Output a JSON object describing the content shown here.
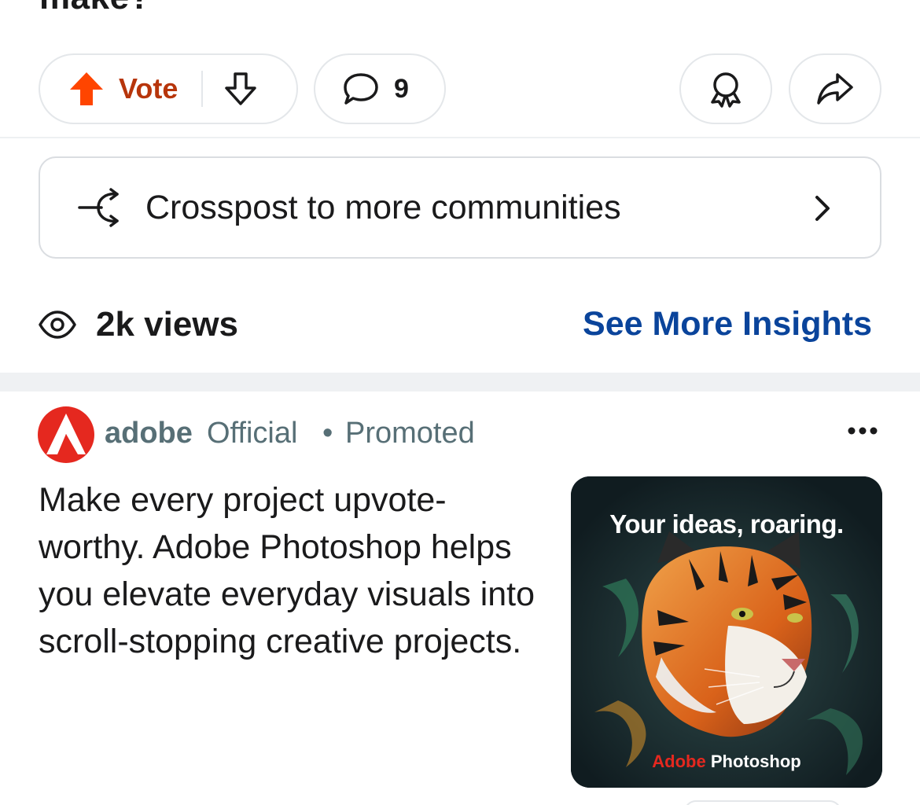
{
  "post": {
    "title_fragment": "make?"
  },
  "actions": {
    "vote_label": "Vote",
    "comment_count": "9"
  },
  "crosspost": {
    "label": "Crosspost to more communities"
  },
  "stats": {
    "views_label": "2k views",
    "insights_link": "See More Insights"
  },
  "ad": {
    "advertiser": "adobe",
    "official_label": "Official",
    "separator": "•",
    "promoted_label": "Promoted",
    "body": "Make every project upvote-worthy. Adobe Photoshop helps you elevate everyday visuals into scroll-stopping creative projects.",
    "image": {
      "headline": "Your ideas, roaring.",
      "brand_adobe": "Adobe",
      "brand_product": "Photoshop"
    }
  },
  "colors": {
    "upvote": "#ff4500",
    "vote_text": "#b7350b",
    "link": "#0a449b",
    "meta_text": "#576f76",
    "adobe_red": "#e5281f"
  },
  "icons": {
    "upvote": "upvote-arrow-icon",
    "downvote": "downvote-arrow-icon",
    "comment": "comment-bubble-icon",
    "award": "award-ribbon-icon",
    "share": "share-arrow-icon",
    "crosspost": "crosspost-icon",
    "chevron": "chevron-right-icon",
    "views": "eye-icon",
    "more": "more-dots-icon"
  }
}
